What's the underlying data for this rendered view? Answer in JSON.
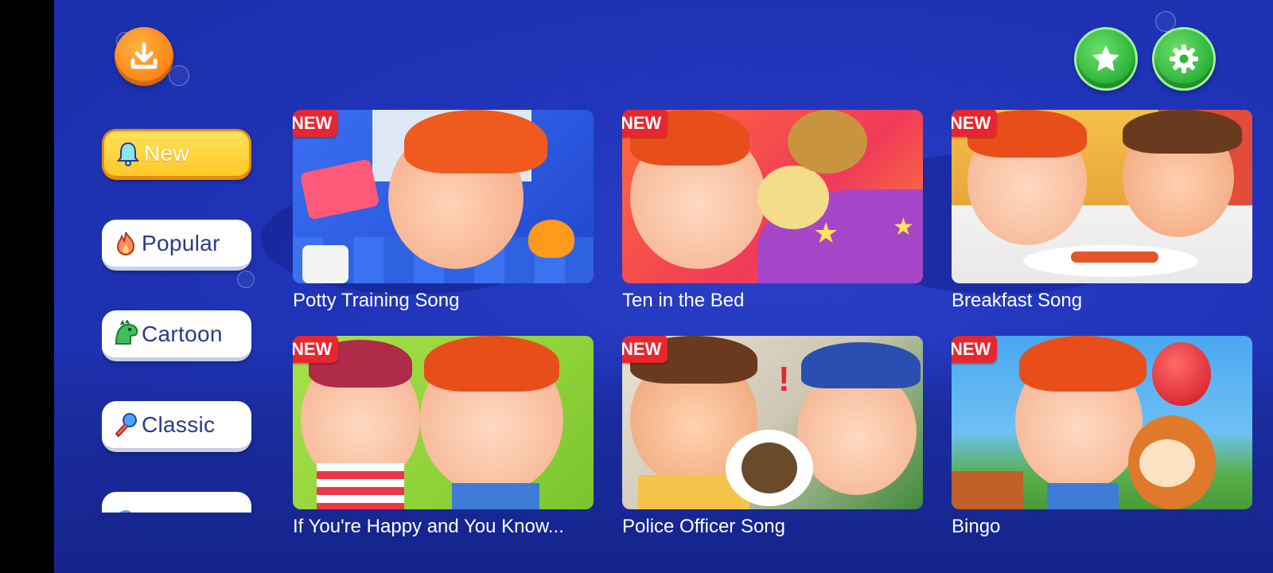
{
  "top_bar": {
    "download_icon": "download-icon",
    "favorites_icon": "star-icon",
    "settings_icon": "gear-icon"
  },
  "sidebar": {
    "items": [
      {
        "label": "New",
        "icon": "bell-icon",
        "active": true
      },
      {
        "label": "Popular",
        "icon": "fire-icon",
        "active": false
      },
      {
        "label": "Cartoon",
        "icon": "dinosaur-icon",
        "active": false
      },
      {
        "label": "Classic",
        "icon": "microphone-icon",
        "active": false
      }
    ]
  },
  "videos": [
    {
      "title": "Potty Training Song",
      "badge": "NEW"
    },
    {
      "title": "Ten in the Bed",
      "badge": "NEW"
    },
    {
      "title": "Breakfast Song",
      "badge": "NEW"
    },
    {
      "title": "If You're Happy and You Know...",
      "badge": "NEW"
    },
    {
      "title": "Police Officer Song",
      "badge": "NEW"
    },
    {
      "title": "Bingo",
      "badge": "NEW"
    }
  ],
  "colors": {
    "background": "#1f34b8",
    "active_tab": "#ffc928",
    "badge": "#e8262f",
    "download_button": "#ff8a1a",
    "green_button": "#2eb43a"
  }
}
